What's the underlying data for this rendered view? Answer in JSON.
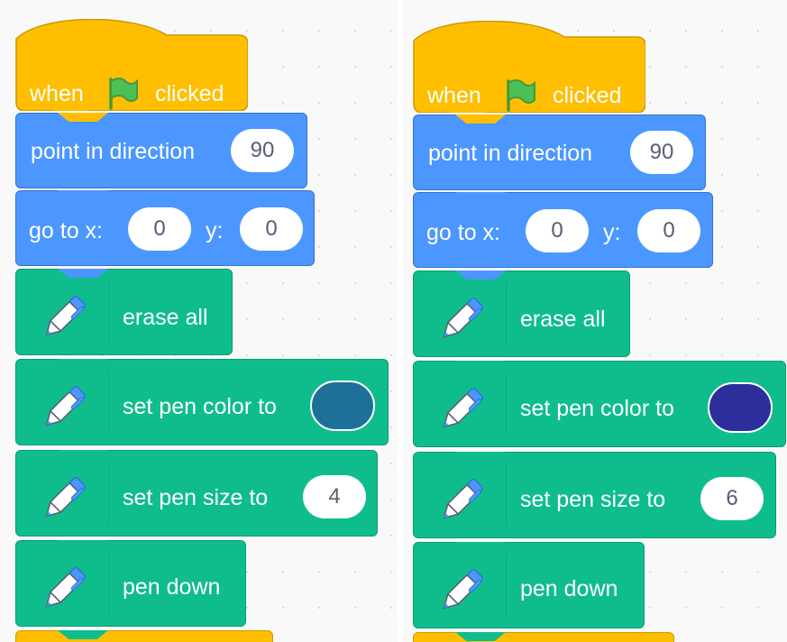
{
  "colors": {
    "events": "#ffbf00",
    "motion": "#4c97ff",
    "pen": "#0fbd8c",
    "pill_text": "#575e75",
    "flag": "#4cbf56"
  },
  "icons": {
    "flag": "green-flag-icon",
    "pen": "pen-icon"
  },
  "scripts": [
    {
      "hat": {
        "when": "when",
        "clicked": "clicked"
      },
      "point_in_direction": {
        "label": "point in direction",
        "value": "90"
      },
      "go_to": {
        "label_x": "go to x:",
        "x": "0",
        "label_y": "y:",
        "y": "0"
      },
      "erase_all": {
        "label": "erase all"
      },
      "set_pen_color": {
        "label": "set pen color to",
        "color": "#1d7198"
      },
      "set_pen_size": {
        "label": "set pen size to",
        "value": "4"
      },
      "pen_down": {
        "label": "pen down"
      }
    },
    {
      "hat": {
        "when": "when",
        "clicked": "clicked"
      },
      "point_in_direction": {
        "label": "point in direction",
        "value": "90"
      },
      "go_to": {
        "label_x": "go to x:",
        "x": "0",
        "label_y": "y:",
        "y": "0"
      },
      "erase_all": {
        "label": "erase all"
      },
      "set_pen_color": {
        "label": "set pen color to",
        "color": "#2c2e9c"
      },
      "set_pen_size": {
        "label": "set pen size to",
        "value": "6"
      },
      "pen_down": {
        "label": "pen down"
      }
    }
  ]
}
